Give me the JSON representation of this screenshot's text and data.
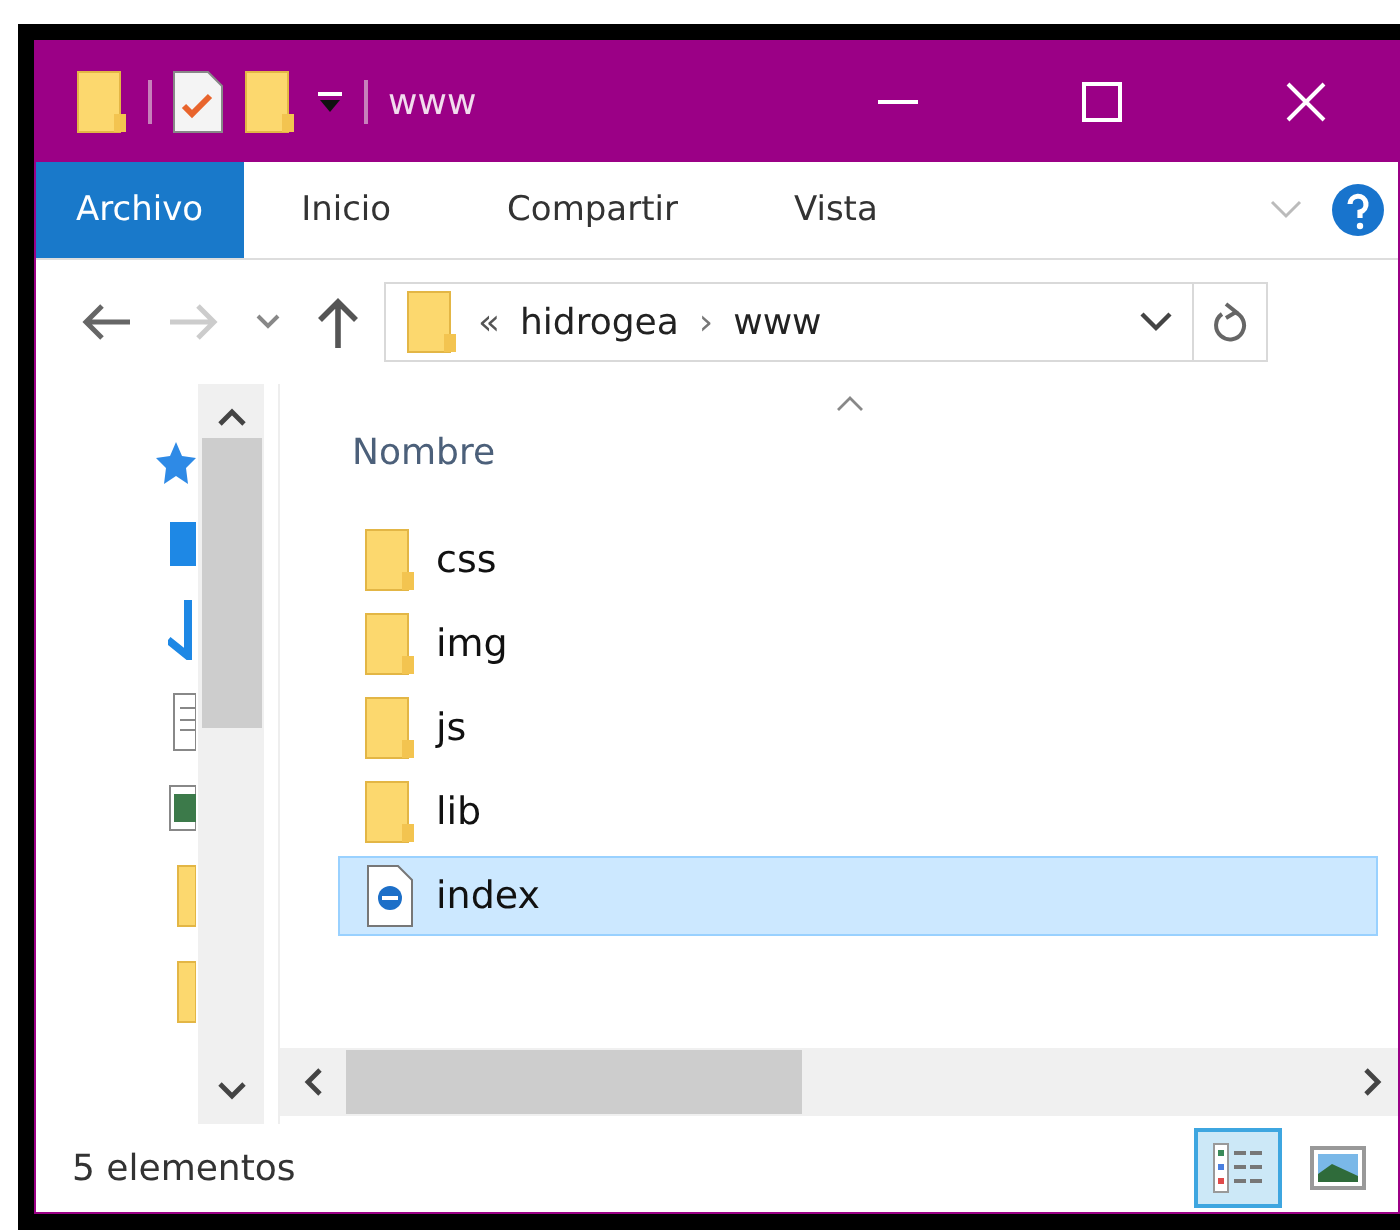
{
  "window": {
    "title": "www"
  },
  "ribbon_tabs": [
    {
      "label": "Archivo",
      "selected": true
    },
    {
      "label": "Inicio",
      "selected": false
    },
    {
      "label": "Compartir",
      "selected": false
    },
    {
      "label": "Vista",
      "selected": false
    }
  ],
  "address": {
    "prefix": "«",
    "path": [
      "hidrogea",
      "www"
    ],
    "separator": "›"
  },
  "column_header": "Nombre",
  "files": [
    {
      "name": "css",
      "kind": "folder",
      "selected": false
    },
    {
      "name": "img",
      "kind": "folder",
      "selected": false
    },
    {
      "name": "js",
      "kind": "folder",
      "selected": false
    },
    {
      "name": "lib",
      "kind": "folder",
      "selected": false
    },
    {
      "name": "index",
      "kind": "html",
      "selected": true
    }
  ],
  "status_bar": {
    "text": "5 elementos"
  },
  "view_buttons": [
    {
      "kind": "details",
      "selected": true
    },
    {
      "kind": "thumbnails",
      "selected": false
    }
  ]
}
